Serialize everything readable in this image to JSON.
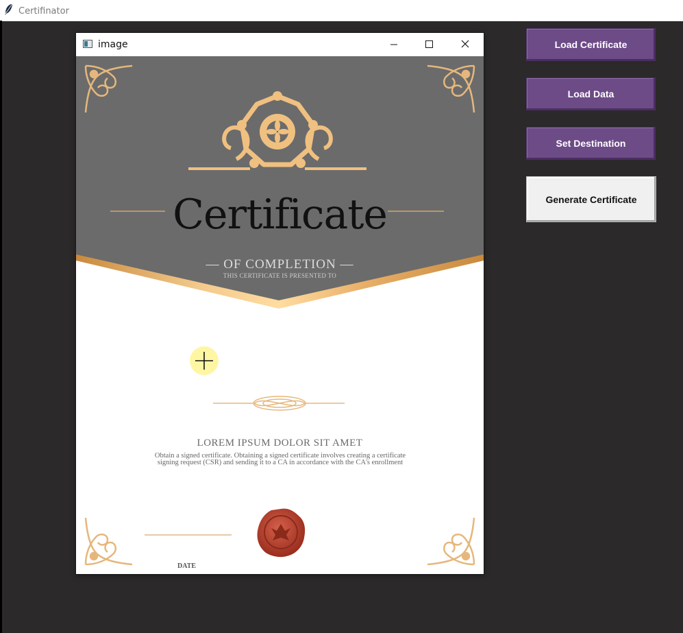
{
  "app": {
    "title": "Certifinator"
  },
  "image_window": {
    "title": "image"
  },
  "certificate": {
    "title": "Certificate",
    "subtitle": "— OF COMPLETION —",
    "presented": "THIS CERTIFICATE IS PRESENTED TO",
    "heading": "LOREM IPSUM DOLOR SIT AMET",
    "body_line1": "Obtain a signed certificate. Obtaining a signed certificate involves creating a certificate",
    "body_line2": "signing request (CSR) and sending it to a CA in accordance with the CA's enrollment",
    "date_label": "DATE"
  },
  "buttons": {
    "load_certificate": "Load Certificate",
    "load_data": "Load Data",
    "set_destination": "Set Destination",
    "generate_certificate": "Generate Certificate"
  },
  "colors": {
    "background": "#2b2929",
    "button_purple": "#6d4b87",
    "gold": "#e8b574",
    "header_gray": "#6b6b6b",
    "seal_red": "#b8402e"
  }
}
